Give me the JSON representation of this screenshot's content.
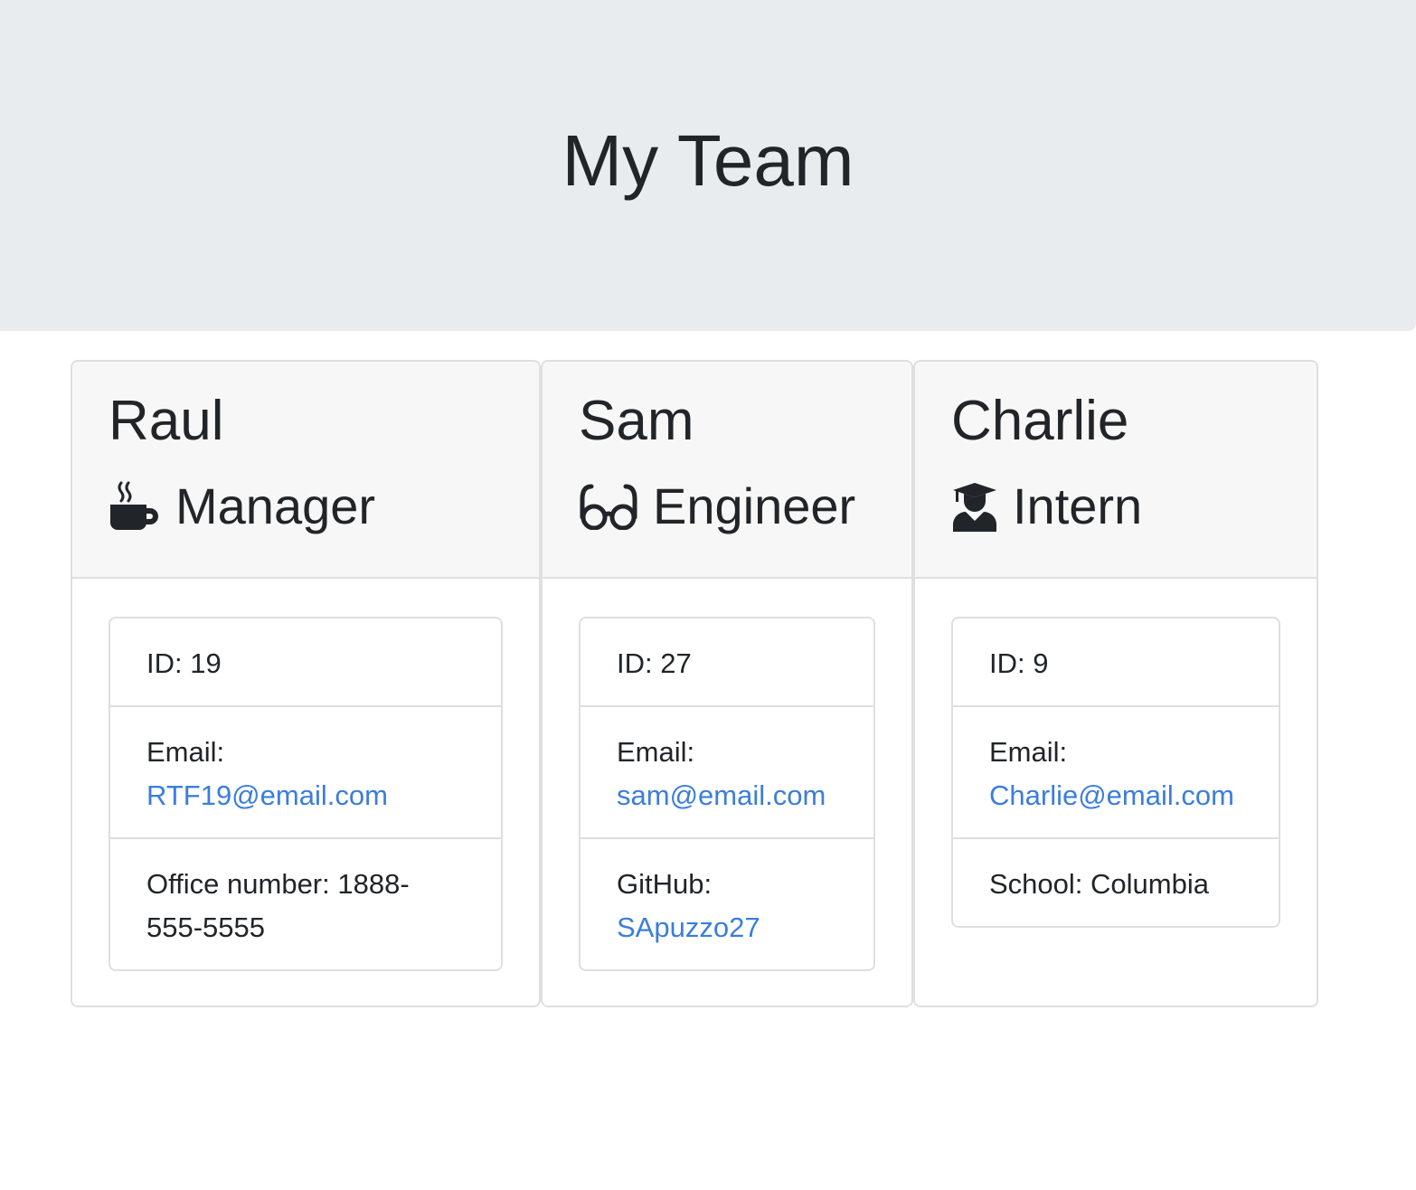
{
  "header": {
    "title": "My Team"
  },
  "cards": [
    {
      "name": "Raul",
      "role": "Manager",
      "role_icon": "coffee-icon",
      "id_text": "ID: 19",
      "email_label": "Email:",
      "email": "RTF19@email.com",
      "extra_text": "Office number: 1888-555-5555"
    },
    {
      "name": "Sam",
      "role": "Engineer",
      "role_icon": "glasses-icon",
      "id_text": "ID: 27",
      "email_label": "Email:",
      "email": "sam@email.com",
      "extra_label": "GitHub:",
      "extra_link": "SApuzzo27"
    },
    {
      "name": "Charlie",
      "role": "Intern",
      "role_icon": "graduate-icon",
      "id_text": "ID: 9",
      "email_label": "Email:",
      "email": "Charlie@email.com",
      "extra_text": "School: Columbia"
    }
  ],
  "colors": {
    "jumbotron_bg": "#e9ecef",
    "link": "#3b7ddd",
    "card_header_bg": "#f7f7f7",
    "border": "#dfdfdf"
  }
}
